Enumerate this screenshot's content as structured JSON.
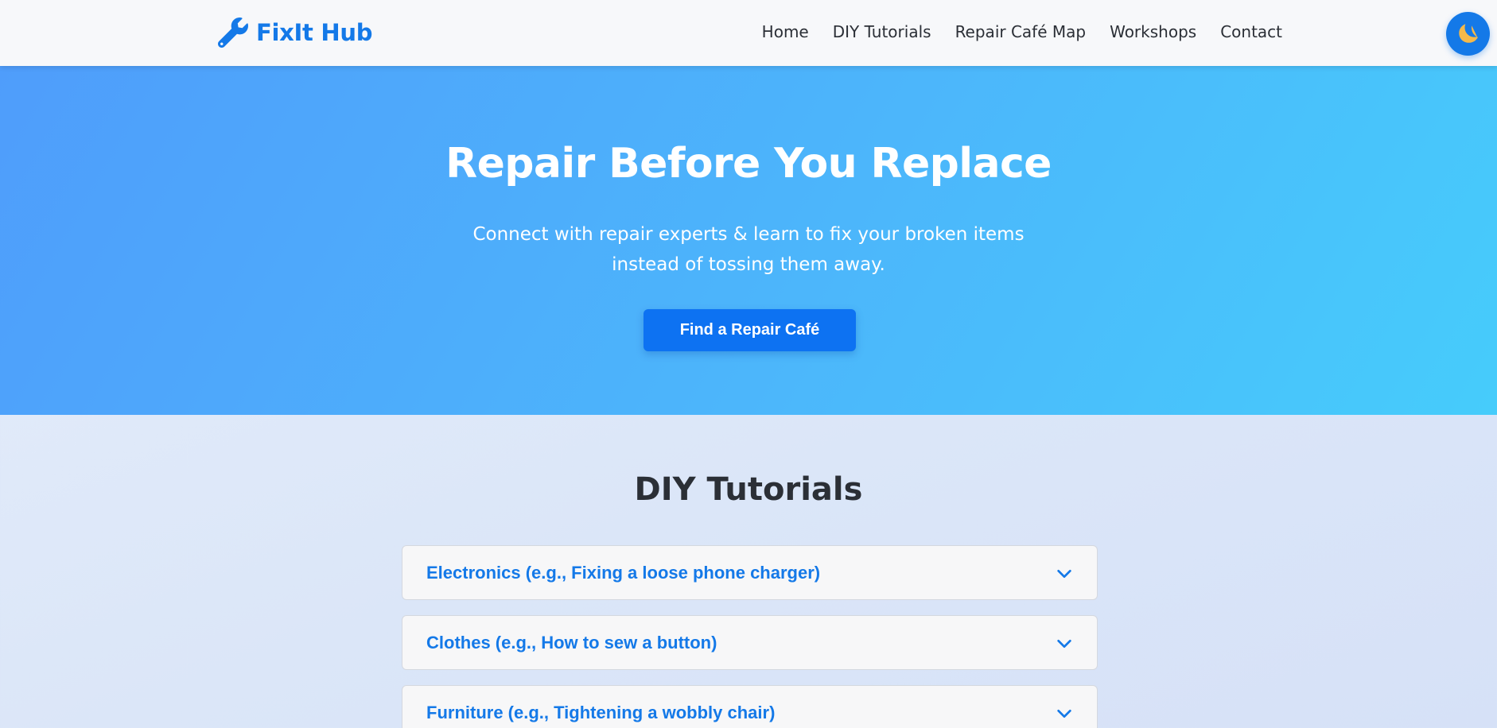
{
  "navbar": {
    "brand_name": "FixIt Hub",
    "brand_icon": "wrench-icon",
    "links": [
      "Home",
      "DIY Tutorials",
      "Repair Café Map",
      "Workshops",
      "Contact"
    ],
    "theme_toggle_icon": "moon-icon"
  },
  "hero": {
    "title": "Repair Before You Replace",
    "subtitle": "Connect with repair experts & learn to fix your broken items instead of tossing them away.",
    "cta_label": "Find a Repair Café"
  },
  "tutorials": {
    "title": "DIY Tutorials",
    "items": [
      "Electronics (e.g., Fixing a loose phone charger)",
      "Clothes (e.g., How to sew a button)",
      "Furniture (e.g., Tightening a wobbly chair)"
    ],
    "expand_icon": "chevron-down-icon"
  },
  "colors": {
    "brand": "#1479e8",
    "cta": "#0d72f2",
    "hero_start": "#4f9dfb",
    "hero_end": "#46ccfb",
    "moon": "#f5b94a"
  }
}
